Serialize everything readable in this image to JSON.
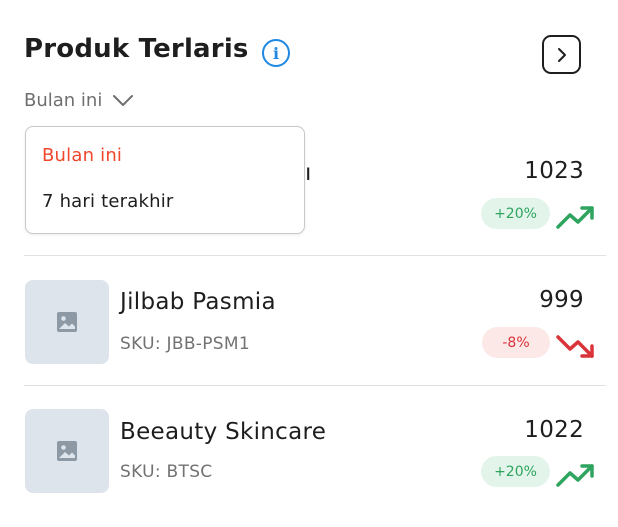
{
  "header": {
    "title": "Produk Terlaris",
    "info_icon": "info-icon",
    "next_icon": "chevron-right-icon"
  },
  "filter": {
    "selected": "Bulan ini",
    "options": [
      "Bulan ini",
      "7 hari terakhir"
    ]
  },
  "products": [
    {
      "name": "",
      "sku": "",
      "count": "1023",
      "change": "+20%",
      "trend": "up"
    },
    {
      "name": "Jilbab Pasmia",
      "sku": "SKU: JBB-PSM1",
      "count": "999",
      "change": "-8%",
      "trend": "down"
    },
    {
      "name": "Beeauty Skincare",
      "sku": "SKU: BTSC",
      "count": "1022",
      "change": "+20%",
      "trend": "up"
    }
  ],
  "colors": {
    "accent": "#f0472c",
    "info": "#1e88e5",
    "positive": "#2ea45f",
    "positive_bg": "#e3f5ea",
    "negative": "#d9343a",
    "negative_bg": "#fde8e8",
    "thumb_bg": "#dde4ec"
  }
}
